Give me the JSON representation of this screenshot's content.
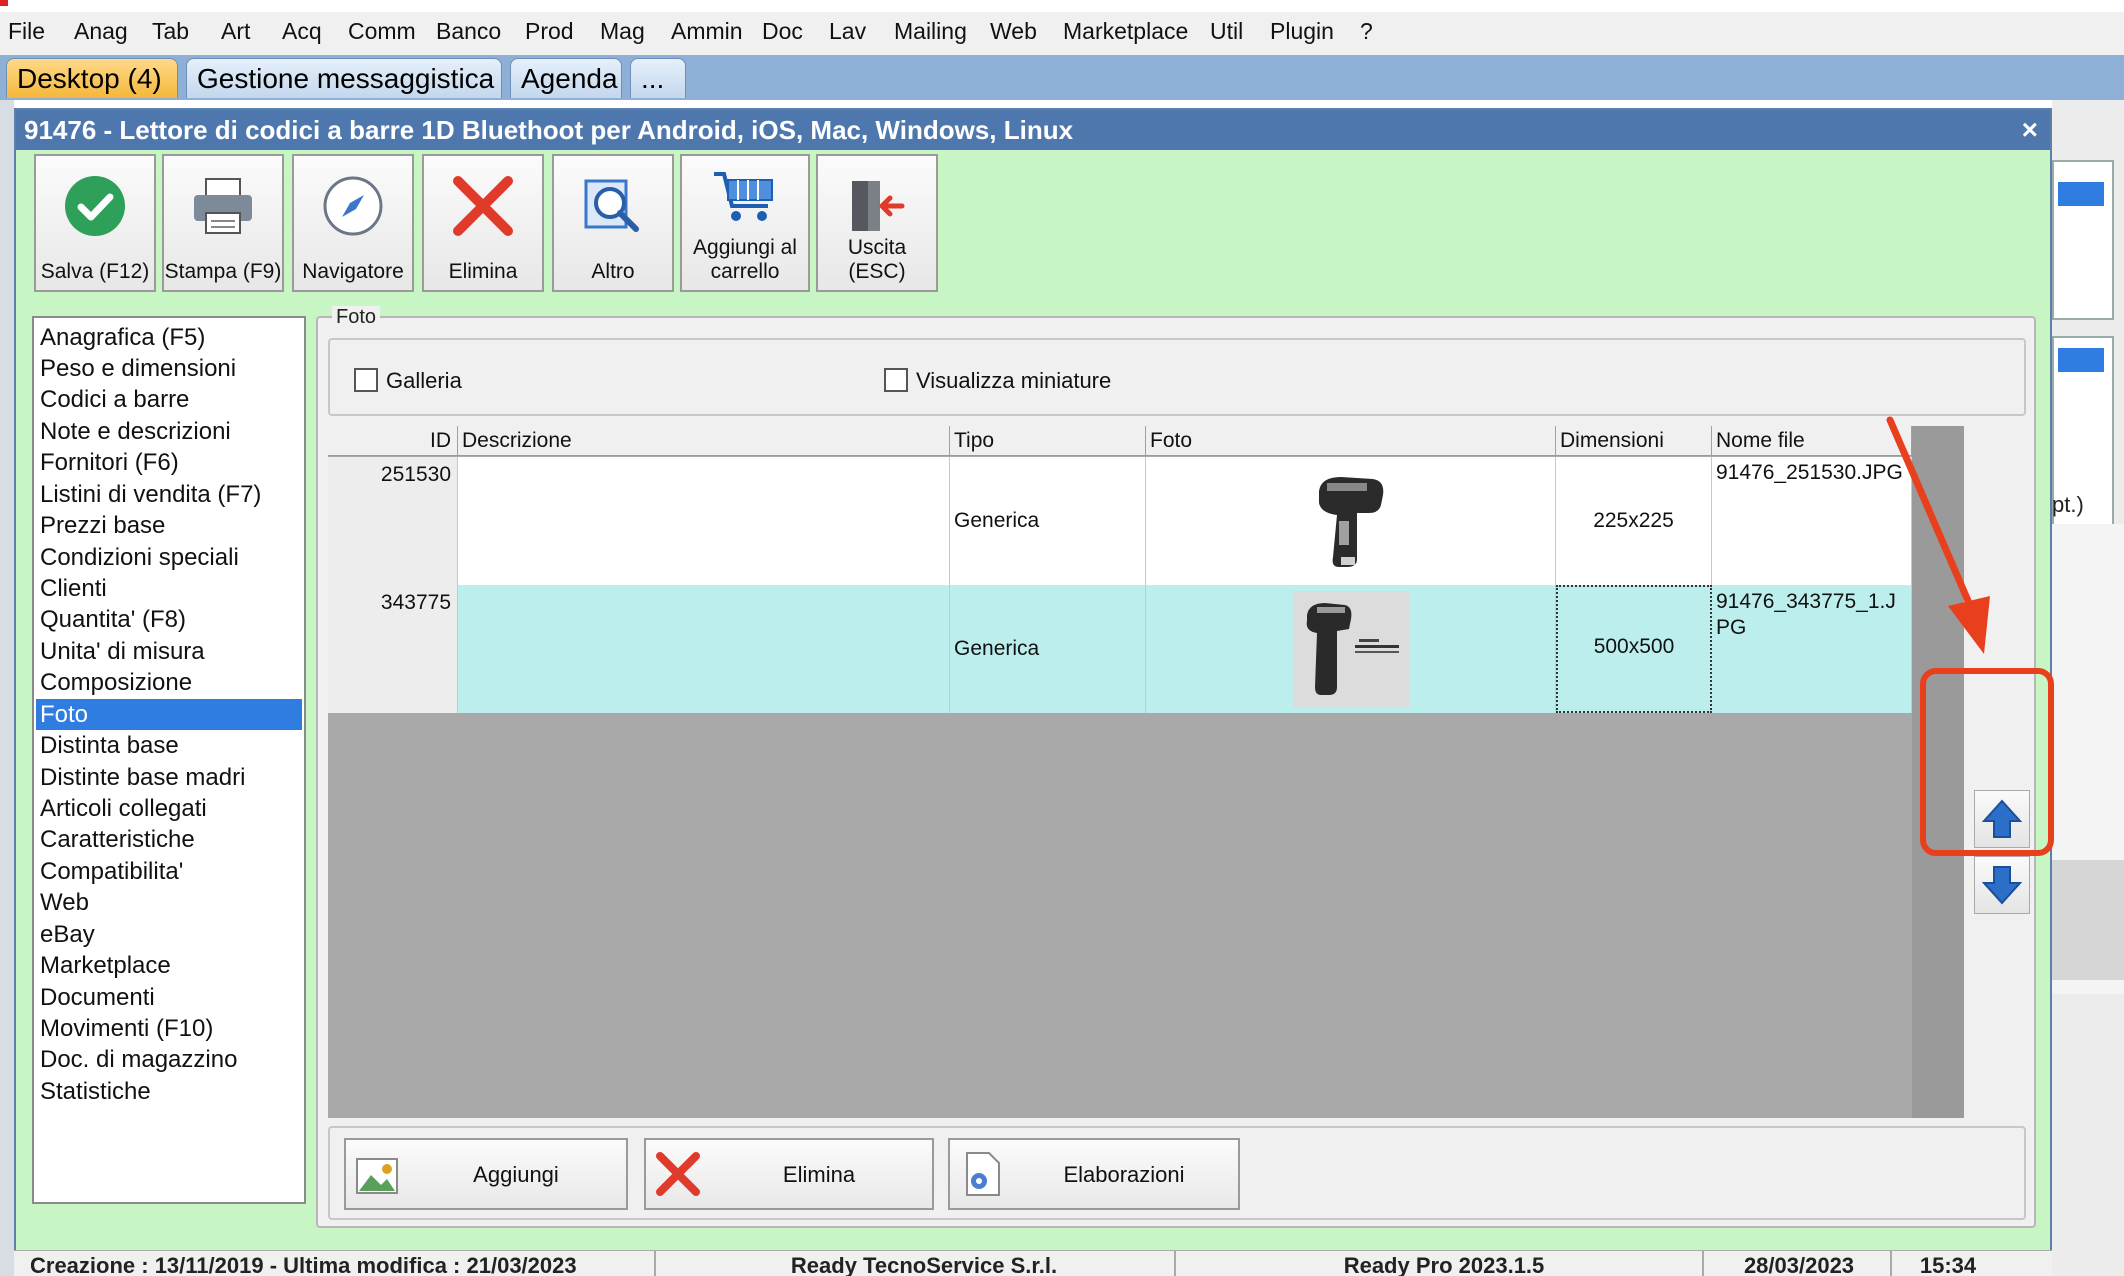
{
  "menubar": {
    "items": [
      "File",
      "Anag",
      "Tab",
      "Art",
      "Acq",
      "Comm",
      "Banco",
      "Prod",
      "Mag",
      "Ammin",
      "Doc",
      "Lav",
      "Mailing",
      "Web",
      "Marketplace",
      "Util",
      "Plugin",
      "?"
    ]
  },
  "tabs": [
    "Desktop (4)",
    "Gestione messaggistica",
    "Agenda",
    "..."
  ],
  "window": {
    "title": "91476 - Lettore di codici a barre 1D Bluethoot  per Android, iOS, Mac, Windows, Linux",
    "close_glyph": "×"
  },
  "toolbar": {
    "save": "Salva (F12)",
    "print": "Stampa (F9)",
    "navigator": "Navigatore",
    "delete": "Elimina",
    "other": "Altro",
    "cart_line1": "Aggiungi al",
    "cart_line2": "carrello",
    "exit": "Uscita (ESC)"
  },
  "nav": {
    "items": [
      "Anagrafica (F5)",
      "Peso e dimensioni",
      "Codici a barre",
      "Note e descrizioni",
      "Fornitori (F6)",
      "Listini di vendita (F7)",
      "Prezzi base",
      "Condizioni speciali",
      "Clienti",
      "Quantita' (F8)",
      "Unita' di misura",
      "Composizione",
      "Foto",
      "Distinta base",
      "Distinte base madri",
      "Articoli collegati",
      "Caratteristiche",
      "Compatibilita'",
      "Web",
      "eBay",
      "Marketplace",
      "Documenti",
      "Movimenti (F10)",
      "Doc. di magazzino",
      "Statistiche"
    ],
    "selected": "Foto"
  },
  "foto": {
    "legend": "Foto",
    "galleria": "Galleria",
    "miniature": "Visualizza miniature",
    "columns": [
      "ID",
      "Descrizione",
      "Tipo",
      "Foto",
      "Dimensioni",
      "Nome file"
    ],
    "rows": [
      {
        "id": "251530",
        "descrizione": "",
        "tipo": "Generica",
        "dimensioni": "225x225",
        "nome_line1": "91476_251530.JPG",
        "nome_line2": ""
      },
      {
        "id": "343775",
        "descrizione": "",
        "tipo": "Generica",
        "dimensioni": "500x500",
        "nome_line1": "91476_343775_1.J",
        "nome_line2": "PG"
      }
    ],
    "actions": {
      "add": "Aggiungi",
      "delete": "Elimina",
      "process": "Elaborazioni"
    }
  },
  "side_peek": {
    "text": "pt.)"
  },
  "status": {
    "created": "Creazione : 13/11/2019 - Ultima modifica : 21/03/2023",
    "company": "Ready TecnoService S.r.l.",
    "version": "Ready Pro 2023.1.5",
    "date": "28/03/2023",
    "time": "15:34"
  },
  "colors": {
    "selection": "#2f7de0",
    "row_highlight": "#bdeeee",
    "window_bg": "#c8f5c4",
    "titlebar": "#4e78ad",
    "annotation": "#e8401c"
  }
}
